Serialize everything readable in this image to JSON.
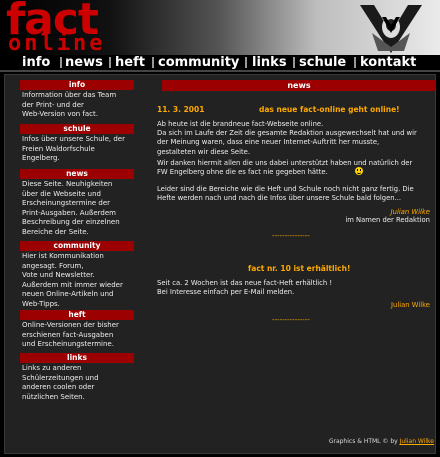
{
  "header": {
    "logo_top": "fact",
    "logo_bottom": "online"
  },
  "nav": {
    "items": [
      "info",
      "news",
      "heft",
      "community",
      "links",
      "schule",
      "kontakt"
    ]
  },
  "sidebar": {
    "items": [
      {
        "title": "info",
        "text": "Information über das Team\nder Print- und der\nWeb-Version von fact."
      },
      {
        "title": "schule",
        "text": "Infos über unsere Schule, der\nFreien Waldorfschule\nEngelberg."
      },
      {
        "title": "news",
        "text": "Diese Seite. Neuhigkeiten\nüber die Webseite und\nErscheinungstermine der\nPrint-Ausgaben. Außerdem\nBeschreibung der einzelnen\nBereiche der Seite."
      },
      {
        "title": "community",
        "text": "Hier ist Kommunikation\nangesagt. Forum,\nVote und Newsletter.\nAußerdem mit immer wieder\nneuen Online-Artikeln und\nWeb-Tipps."
      },
      {
        "title": "heft",
        "text": "Online-Versionen der bisher\nerschienen fact-Ausgaben\nund  Erscheinungstermine."
      },
      {
        "title": "links",
        "text": "Links zu anderen\nSchülerzeitungen  und\nanderen  coolen oder\nnützlichen  Seiten."
      }
    ]
  },
  "main": {
    "heading": "news",
    "news1": {
      "date": "11. 3. 2001",
      "title": "das neue fact-online geht online!",
      "body1": "Ab heute ist die brandneue fact-Webseite online.\nDa sich im Laufe der Zeit die gesamte Redaktion ausgewechselt hat und wir\nder Meinung waren, dass eine neuer Internet-Auftritt her musste,\ngestalteten wir diese Seite.",
      "body2": "Wir danken hiermit allen die uns dabei unterstützt haben und natürlich der\nFW Engelberg ohne die es fact nie gegeben hätte.",
      "body3": "Leider sind die Bereiche wie die Heft und Schule noch nicht ganz fertig. Die\nHefte werden nach und nach die Infos über unsere Schule bald folgen...",
      "signature_name": "Julian Wilke",
      "signature_line": "im Namen der Redaktion"
    },
    "divider": "---------------",
    "news2": {
      "title": "fact nr. 10 ist erhältlich!",
      "body": "Seit ca. 2 Wochen ist das neue fact-Heft erhältlich !\nBei Interesse einfach per E-Mail melden.",
      "signature_name": "Julian Wilke"
    }
  },
  "footer": {
    "prefix": "Graphics & HTML © by ",
    "author": "Julian Wilke"
  },
  "colors": {
    "accent_red": "#9c0000",
    "logo_red": "#cc0000",
    "highlight_orange": "#ffaa00"
  }
}
